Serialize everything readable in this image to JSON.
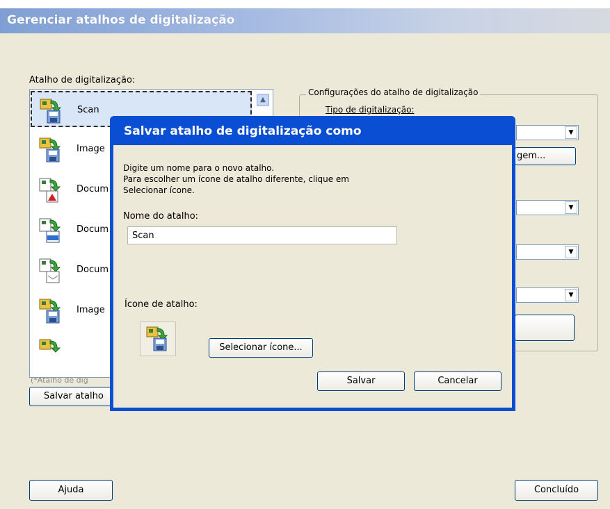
{
  "window": {
    "title": "Gerenciar atalhos de digitalização"
  },
  "list": {
    "label": "Atalho de digitalização:",
    "items": [
      {
        "label": "Scan",
        "icon": "scan-image-icon"
      },
      {
        "label": "Image",
        "icon": "scan-image-icon"
      },
      {
        "label": "Docum",
        "icon": "scan-pdf-icon"
      },
      {
        "label": "Docum",
        "icon": "scan-tiff-icon"
      },
      {
        "label": "Docum",
        "icon": "scan-mail-icon"
      },
      {
        "label": "Image",
        "icon": "scan-image-icon"
      },
      {
        "label": "",
        "icon": "scan-image-icon"
      }
    ],
    "note": "(*Atalho de dig",
    "save_button": "Salvar atalho"
  },
  "settings": {
    "group_title": "Configurações do atalho de digitalização",
    "scan_type_label": "Tipo de digitalização:",
    "image_button_fragment": "gem..."
  },
  "dialog": {
    "title": "Salvar atalho de digitalização como",
    "instructions": [
      "Digite um nome para o novo atalho.",
      "Para escolher um ícone de atalho diferente, clique em",
      "Selecionar ícone."
    ],
    "name_label": "Nome do atalho:",
    "name_value": "Scan",
    "icon_label": "Ícone de atalho:",
    "select_icon_button": "Selecionar ícone...",
    "save_button": "Salvar",
    "cancel_button": "Cancelar"
  },
  "footer": {
    "help_button": "Ajuda",
    "done_button": "Concluído"
  },
  "colors": {
    "dialog_titlebar": "#0a4fd3",
    "window_bg": "#ece9d8",
    "selection_bg": "#d9e6f7"
  }
}
